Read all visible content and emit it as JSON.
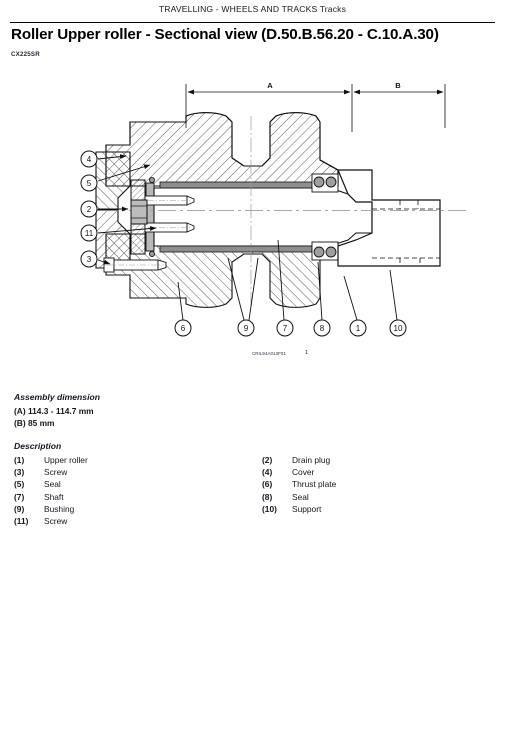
{
  "header": {
    "running_title": "TRAVELLING - WHEELS AND TRACKS Tracks",
    "title": "Roller Upper roller - Sectional view (D.50.B.56.20 - C.10.A.30)",
    "model_code": "CX225SR"
  },
  "figure": {
    "caption_code": "CRIL94A013F01",
    "figure_number": "1",
    "dimension_labels": [
      "A",
      "B"
    ],
    "callouts_left": [
      "4",
      "5",
      "2",
      "11",
      "3"
    ],
    "callouts_bottom": [
      "6",
      "9",
      "7",
      "8",
      "1",
      "10"
    ]
  },
  "assembly": {
    "heading": "Assembly dimension",
    "lines": [
      "(A) 114.3 - 114.7 mm",
      "(B) 85 mm"
    ]
  },
  "description": {
    "heading": "Description",
    "left": [
      {
        "num": "(1)",
        "label": "Upper roller"
      },
      {
        "num": "(3)",
        "label": "Screw"
      },
      {
        "num": "(5)",
        "label": "Seal"
      },
      {
        "num": "(7)",
        "label": "Shaft"
      },
      {
        "num": "(9)",
        "label": "Bushing"
      },
      {
        "num": "(11)",
        "label": "Screw"
      }
    ],
    "right": [
      {
        "num": "(2)",
        "label": "Drain plug"
      },
      {
        "num": "(4)",
        "label": "Cover"
      },
      {
        "num": "(6)",
        "label": "Thrust plate"
      },
      {
        "num": "(8)",
        "label": "Seal"
      },
      {
        "num": "(10)",
        "label": "Support"
      }
    ]
  },
  "colors": {
    "ink": "#16161f",
    "rule": "#000000",
    "hatch": "#333333",
    "metal_fill": "#b9b9b9",
    "page": "#ffffff"
  }
}
